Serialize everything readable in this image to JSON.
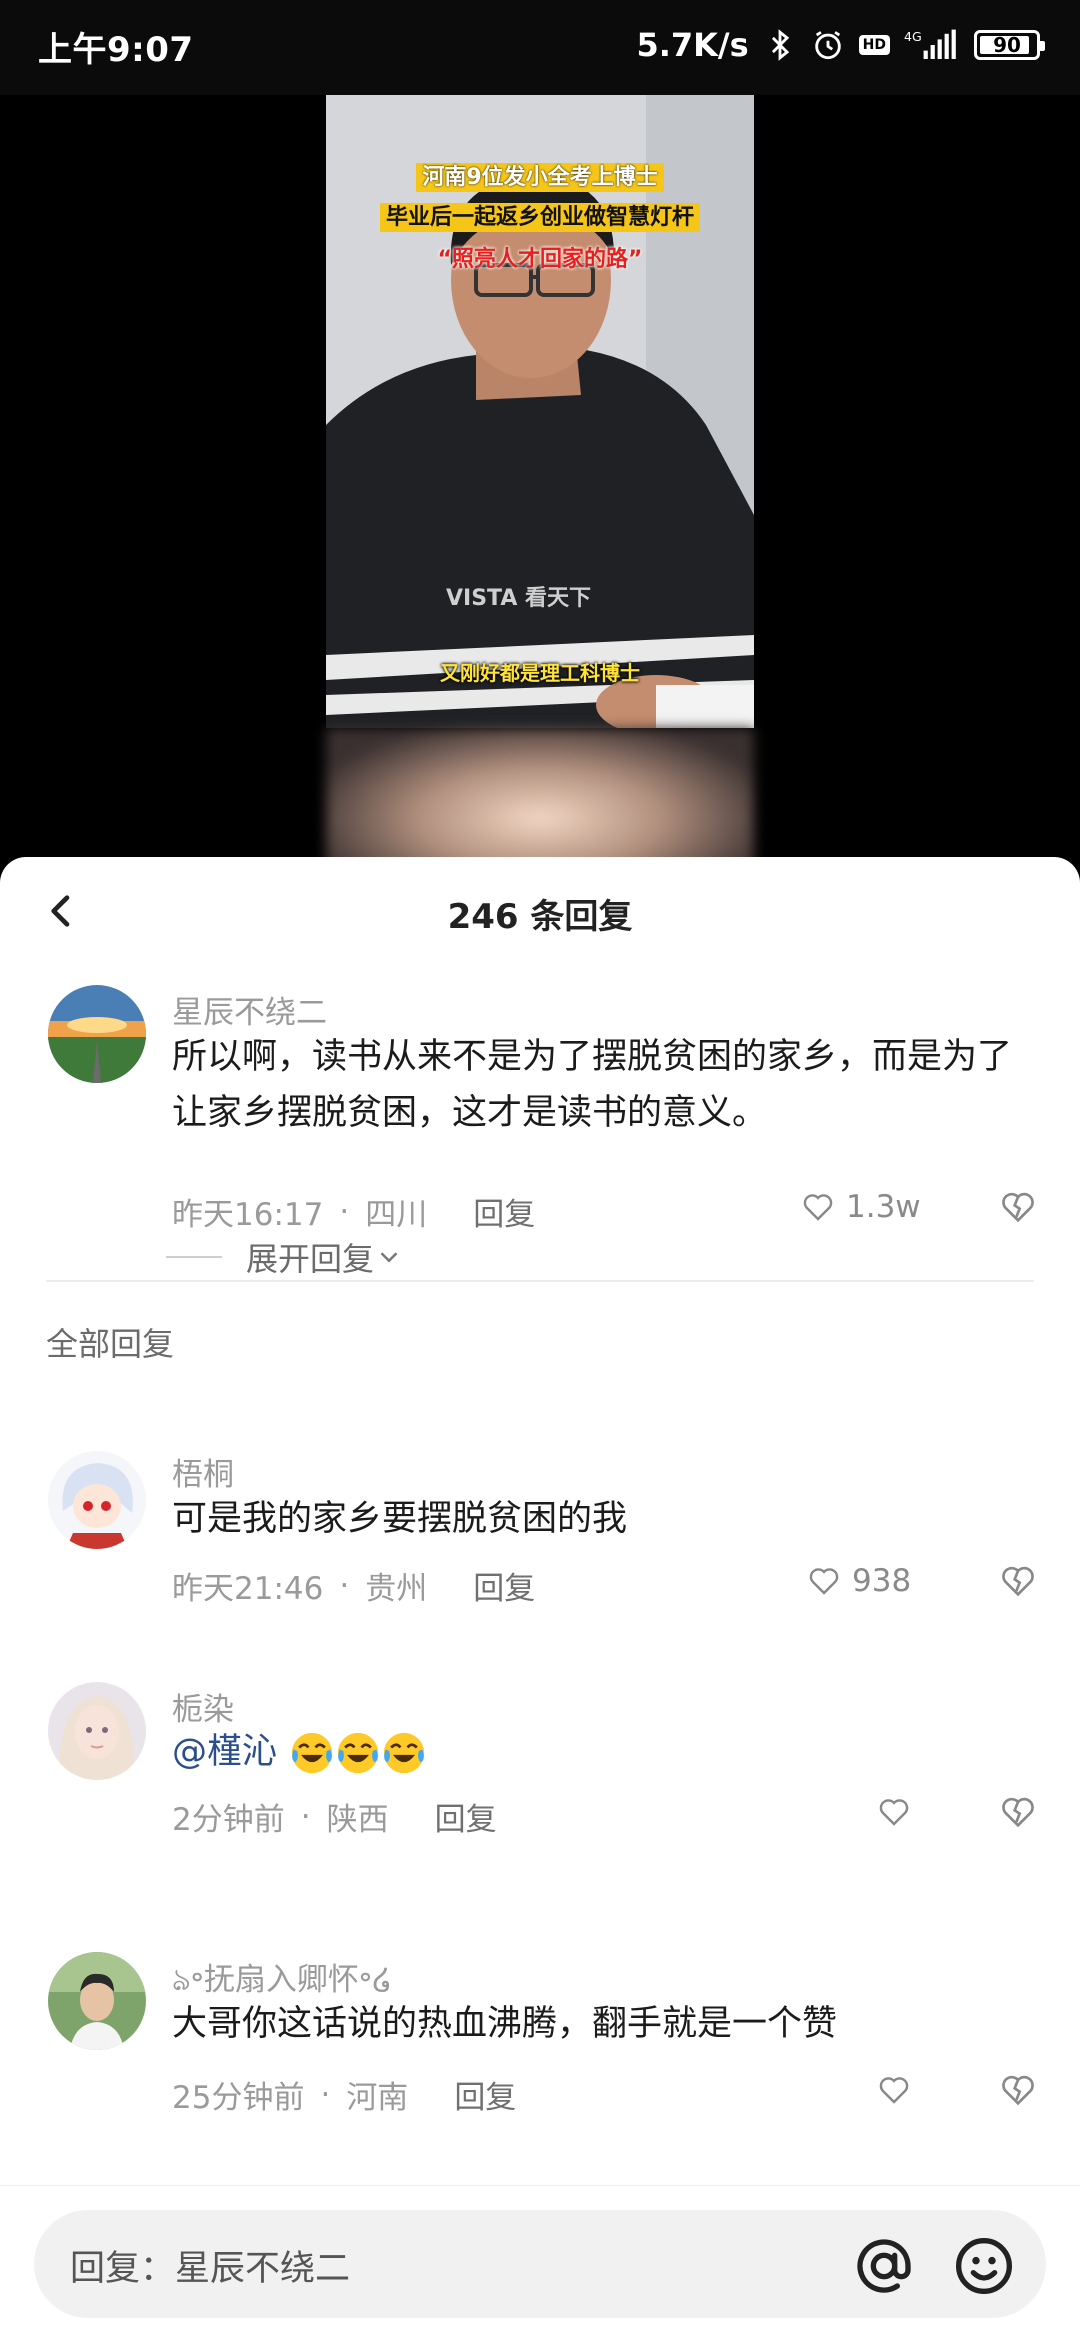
{
  "status_bar": {
    "time": "上午9:07",
    "net_speed": "5.7K/s",
    "network": "4G",
    "hd": "HD",
    "battery": "90",
    "battery_level": 0.9
  },
  "video": {
    "caption_line1": "河南9位发小全考上博士",
    "caption_line2": "毕业后一起返乡创业做智慧灯杆",
    "caption_line3": "“照亮人才回家的路”",
    "subtitle": "又刚好都是理工科博士",
    "watermark": "VISTA 看天下"
  },
  "sheet": {
    "title": "246 条回复",
    "section_title": "全部回复",
    "expand_label": "展开回复",
    "input_placeholder": "回复：星辰不绕二"
  },
  "main_comment": {
    "username": "星辰不绕二",
    "text": "所以啊，读书从来不是为了摆脱贫困的家乡，而是为了让家乡摆脱贫困，这才是读书的意义。",
    "time": "昨天16:17",
    "location": "四川",
    "reply_label": "回复",
    "likes": "1.3w"
  },
  "replies": [
    {
      "username": "梧桐",
      "text": "可是我的家乡要摆脱贫困的我",
      "time": "昨天21:46",
      "location": "贵州",
      "reply_label": "回复",
      "likes": "938"
    },
    {
      "username": "栀染",
      "mention": "@槿沁",
      "time": "2分钟前",
      "location": "陕西",
      "reply_label": "回复",
      "likes": ""
    },
    {
      "username": "ঌ॰抚扇入卿怀॰໒",
      "text": "大哥你这话说的热血沸腾，翻手就是一个赞",
      "time": "25分钟前",
      "location": "河南",
      "reply_label": "回复",
      "likes": ""
    }
  ],
  "icons": {
    "back": "chevron-left-icon",
    "like": "heart-outline-icon",
    "dislike": "broken-heart-icon",
    "at": "at-sign-icon",
    "emoji": "smiley-icon"
  }
}
